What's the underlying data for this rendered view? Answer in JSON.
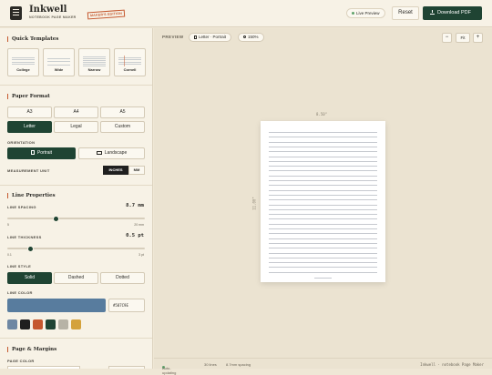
{
  "header": {
    "brand": "Inkwell",
    "subtitle": "NOTEBOOK PAGE MAKER",
    "badge": "MAKER'S EDITION",
    "live_preview": "Live Preview",
    "reset": "Reset",
    "download": "Download PDF"
  },
  "sidebar": {
    "templates_title": "Quick Templates",
    "templates": [
      {
        "label": "College"
      },
      {
        "label": "Wide"
      },
      {
        "label": "Narrow"
      },
      {
        "label": "Cornell"
      }
    ],
    "paper_title": "Paper Format",
    "sizes": [
      "A3",
      "A4",
      "A5",
      "Letter",
      "Legal",
      "Custom"
    ],
    "selected_size": "Letter",
    "orientation_label": "ORIENTATION",
    "orientation_options": [
      "Portrait",
      "Landscape"
    ],
    "selected_orientation": "Portrait",
    "unit_label": "MEASUREMENT UNIT",
    "units": [
      "INCHES",
      "MM"
    ],
    "selected_unit": "INCHES",
    "line_title": "Line Properties",
    "spacing_label": "LINE SPACING",
    "spacing_value": "8.7 mm",
    "spacing_min": "5",
    "spacing_max": "20 mm",
    "spacing_fraction": 0.35,
    "thickness_label": "LINE THICKNESS",
    "thickness_value": "0.5 pt",
    "thickness_min": "0.1",
    "thickness_max": "3 pt",
    "thickness_fraction": 0.15,
    "style_label": "LINE STYLE",
    "styles": [
      "Solid",
      "Dashed",
      "Dotted"
    ],
    "selected_style": "Solid",
    "color_label": "LINE COLOR",
    "color_hex": "#587C9E",
    "swatches": [
      "#6e87a3",
      "#1f1f1f",
      "#c5572e",
      "#1f4433",
      "#b7b3a6",
      "#d4a23c"
    ],
    "page_title": "Page & Margins",
    "page_color_label": "PAGE COLOR"
  },
  "preview": {
    "label": "PREVIEW",
    "paper_pill": "Letter · Portrait",
    "zoom_pill": "150%",
    "fit": "Fit",
    "zoom_out": "−",
    "zoom_in": "+",
    "width_dim": "8.50\"",
    "height_dim": "11.00\"",
    "ruled_lines": 30
  },
  "status": {
    "auto": "Auto-updating",
    "lines": "30 lines",
    "spacing": "8.7mm spacing",
    "credit": "Inkwell · notebook Page Maker"
  }
}
